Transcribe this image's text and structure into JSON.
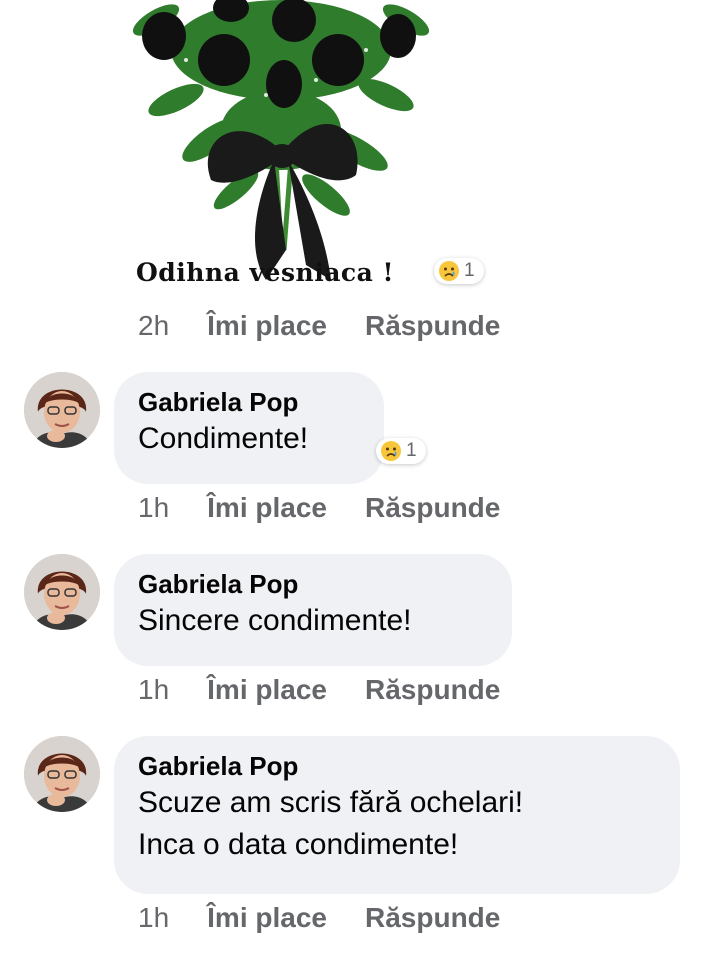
{
  "post": {
    "image_caption": "Odihna vesniaca !",
    "reaction": {
      "icon": "sad-emoji-icon",
      "count": "1"
    },
    "meta": {
      "time": "2h",
      "like": "Îmi place",
      "reply": "Răspunde"
    }
  },
  "comments": [
    {
      "author": "Gabriela Pop",
      "lines": [
        "Condimente!"
      ],
      "reaction": {
        "icon": "sad-emoji-icon",
        "count": "1"
      },
      "meta": {
        "time": "1h",
        "like": "Îmi place",
        "reply": "Răspunde"
      }
    },
    {
      "author": "Gabriela Pop",
      "lines": [
        "Sincere condimente!"
      ],
      "meta": {
        "time": "1h",
        "like": "Îmi place",
        "reply": "Răspunde"
      }
    },
    {
      "author": "Gabriela Pop",
      "lines": [
        "Scuze am scris fără ochelari!",
        "Inca o data condimente!"
      ],
      "meta": {
        "time": "1h",
        "like": "Îmi place",
        "reply": "Răspunde"
      }
    }
  ]
}
